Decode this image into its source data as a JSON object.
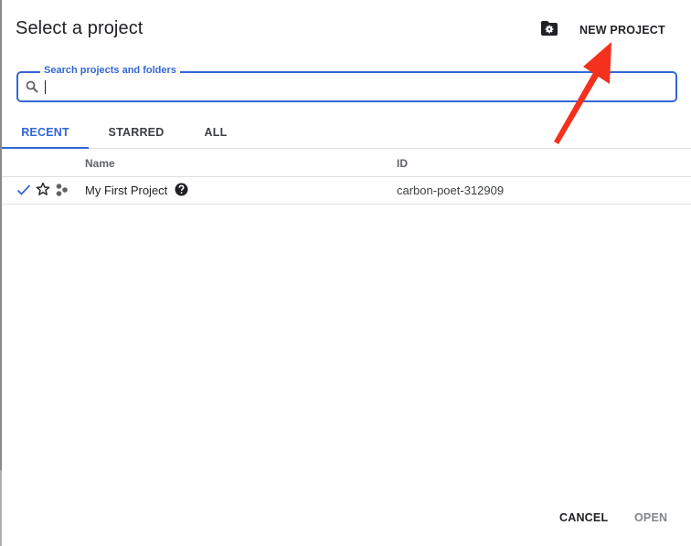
{
  "dialog": {
    "title": "Select a project",
    "new_project_label": "NEW PROJECT",
    "new_project_icon": "folder-settings-icon"
  },
  "search": {
    "label": "Search projects and folders",
    "value": "",
    "placeholder": "",
    "icon": "search-icon"
  },
  "tabs": [
    {
      "label": "RECENT",
      "active": true
    },
    {
      "label": "STARRED",
      "active": false
    },
    {
      "label": "ALL",
      "active": false
    }
  ],
  "table": {
    "columns": [
      "Name",
      "ID"
    ],
    "rows": [
      {
        "selected": true,
        "starred": false,
        "name": "My First Project",
        "id": "carbon-poet-312909"
      }
    ]
  },
  "footer": {
    "cancel_label": "CANCEL",
    "open_label": "OPEN"
  },
  "annotation": {
    "type": "arrow",
    "target": "new-project-button",
    "color": "#f4311d"
  },
  "colors": {
    "accent": "#3367d6",
    "text": "#202124",
    "disabled": "#80868b",
    "divider": "#e0e0e0"
  }
}
